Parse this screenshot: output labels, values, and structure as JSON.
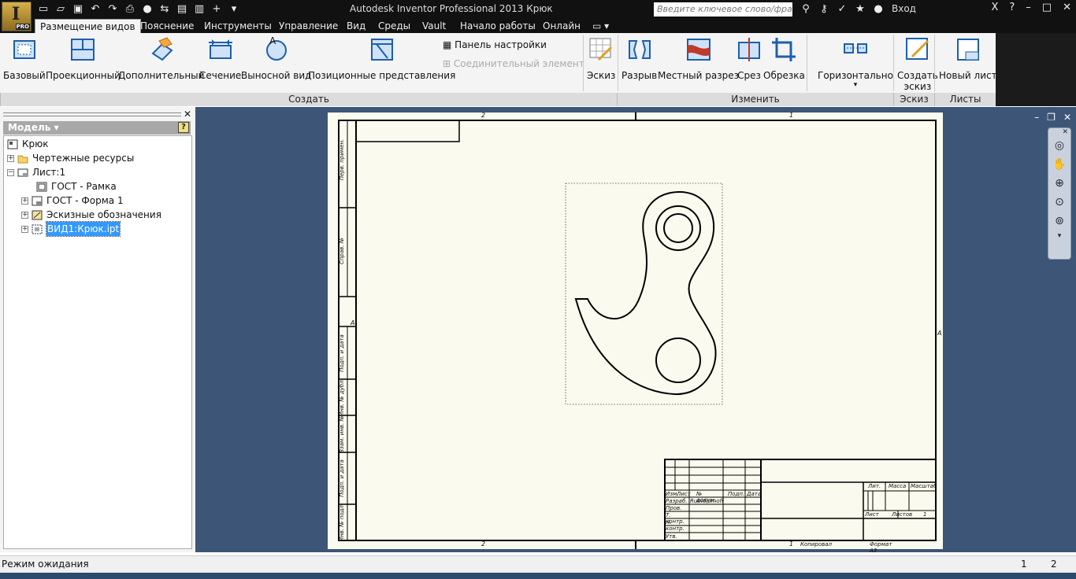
{
  "app": {
    "title": "Autodesk Inventor Professional 2013   Крюк",
    "logo_text": "PRO",
    "search_placeholder": "Введите ключевое слово/фразу",
    "sign_in": "Вход"
  },
  "tabs": [
    "Размещение видов",
    "Пояснение",
    "Инструменты",
    "Управление",
    "Вид",
    "Среды",
    "Vault",
    "Начало работы",
    "Онлайн"
  ],
  "ribbon": {
    "create": [
      "Базовый",
      "Проекционный",
      "Дополнительный",
      "Сечение",
      "Выносной вид",
      "Позиционные представления"
    ],
    "panel_settings": "Панель настройки",
    "connecting_element": "Соединительный элемент",
    "sketch": "Эскиз",
    "modify": [
      "Разрыв",
      "Местный разрез",
      "Срез",
      "Обрезка"
    ],
    "horizontal": "Горизонтально",
    "create_sketch_1": "Создать",
    "create_sketch_2": "эскиз",
    "new_sheet": "Новый лист",
    "panels": {
      "create": "Создать",
      "modify": "Изменить",
      "sketch": "Эскиз",
      "sheets": "Листы"
    }
  },
  "browser": {
    "header": "Модель",
    "help": "?",
    "tree": [
      {
        "label": "Крюк"
      },
      {
        "label": "Чертежные ресурсы"
      },
      {
        "label": "Лист:1"
      },
      {
        "label": "ГОСТ - Рамка"
      },
      {
        "label": "ГОСТ - Форма 1"
      },
      {
        "label": "Эскизные обозначения"
      },
      {
        "label": "ВИД1:Крюк.ipt"
      }
    ]
  },
  "drawing": {
    "zone_top": [
      "2",
      "1"
    ],
    "zone_bottom": [
      "2",
      "1"
    ],
    "zone_side": "A",
    "left_strip": [
      "Перв. примен.",
      "Справ. №",
      "Подп. и дата",
      "Инв. № дубл.",
      "Взам. инв. №",
      "Подп. и дата",
      "Инв. № подл."
    ],
    "title_block": {
      "cols": [
        "Изм.",
        "Лист",
        "№ докум.",
        "Подп.",
        "Дата"
      ],
      "rows": [
        "Разраб.",
        "Пров.",
        "Т. контр.",
        "Н. контр.",
        "Утв."
      ],
      "developer": "Rubidiumoff",
      "lit": "Лит.",
      "mass": "Масса",
      "scale": "Масштаб",
      "sheet": "Лист",
      "sheets": "Листов",
      "sheets_count": "1",
      "copied": "Копировал",
      "format": "Формат A3"
    }
  },
  "status": {
    "text": "Режим ожидания",
    "num1": "1",
    "num2": "2"
  }
}
